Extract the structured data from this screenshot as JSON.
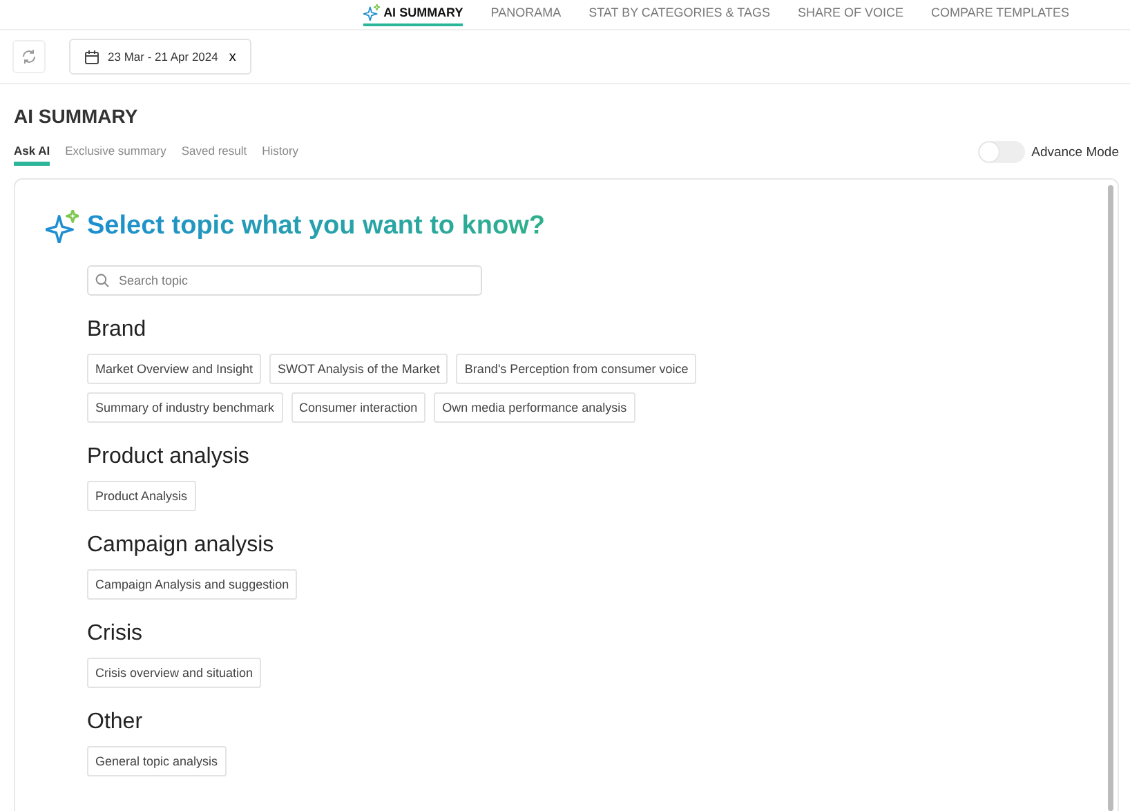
{
  "nav_tabs": [
    {
      "label": "AI SUMMARY",
      "selected": true,
      "icon": true
    },
    {
      "label": "PANORAMA",
      "selected": false
    },
    {
      "label": "STAT BY CATEGORIES & TAGS",
      "selected": false
    },
    {
      "label": "SHARE OF VOICE",
      "selected": false
    },
    {
      "label": "COMPARE TEMPLATES",
      "selected": false
    }
  ],
  "date_range": {
    "value": "23 Mar - 21 Apr 2024",
    "clear": "x"
  },
  "page_title": "AI SUMMARY",
  "sub_tabs": [
    {
      "label": "Ask AI",
      "selected": true
    },
    {
      "label": "Exclusive summary",
      "selected": false
    },
    {
      "label": "Saved result",
      "selected": false
    },
    {
      "label": "History",
      "selected": false
    }
  ],
  "advance_mode": {
    "label": "Advance Mode",
    "on": false
  },
  "heading": "Select topic what you want to know?",
  "search": {
    "placeholder": "Search topic"
  },
  "groups": [
    {
      "title": "Brand",
      "topics": [
        "Market Overview and Insight",
        "SWOT Analysis of the Market",
        "Brand's Perception from consumer voice",
        "Summary of industry benchmark",
        "Consumer interaction",
        "Own media performance analysis"
      ]
    },
    {
      "title": "Product analysis",
      "topics": [
        "Product Analysis"
      ]
    },
    {
      "title": "Campaign analysis",
      "topics": [
        "Campaign Analysis and suggestion"
      ]
    },
    {
      "title": "Crisis",
      "topics": [
        "Crisis overview and situation"
      ]
    },
    {
      "title": "Other",
      "topics": [
        "General topic analysis"
      ]
    }
  ]
}
